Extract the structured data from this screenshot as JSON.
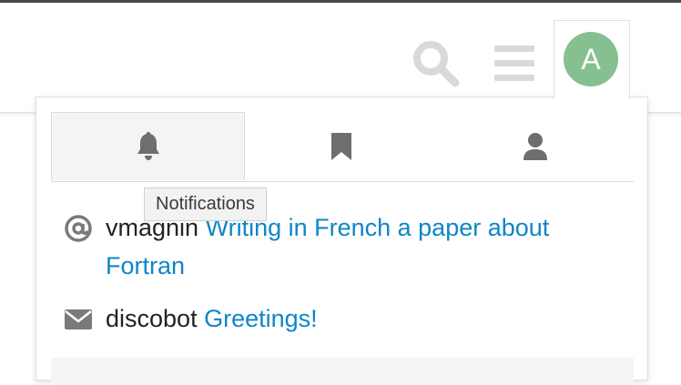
{
  "header": {
    "search_icon": "search-icon",
    "menu_icon": "hamburger-menu-icon",
    "avatar_letter": "A",
    "avatar_color": "#86c091"
  },
  "panel": {
    "tabs": [
      {
        "icon": "bell-icon",
        "active": true
      },
      {
        "icon": "bookmark-icon",
        "active": false
      },
      {
        "icon": "user-icon",
        "active": false
      }
    ],
    "tooltip": "Notifications",
    "notifications": [
      {
        "icon": "at-sign-icon",
        "user": "vmagnin",
        "title": "Writing in French a paper about Fortran"
      },
      {
        "icon": "envelope-icon",
        "user": "discobot",
        "title": "Greetings!"
      }
    ]
  },
  "colors": {
    "link": "#0f85c8",
    "icon_gray": "#d9d9d9",
    "tab_icon": "#6e6e6e"
  }
}
